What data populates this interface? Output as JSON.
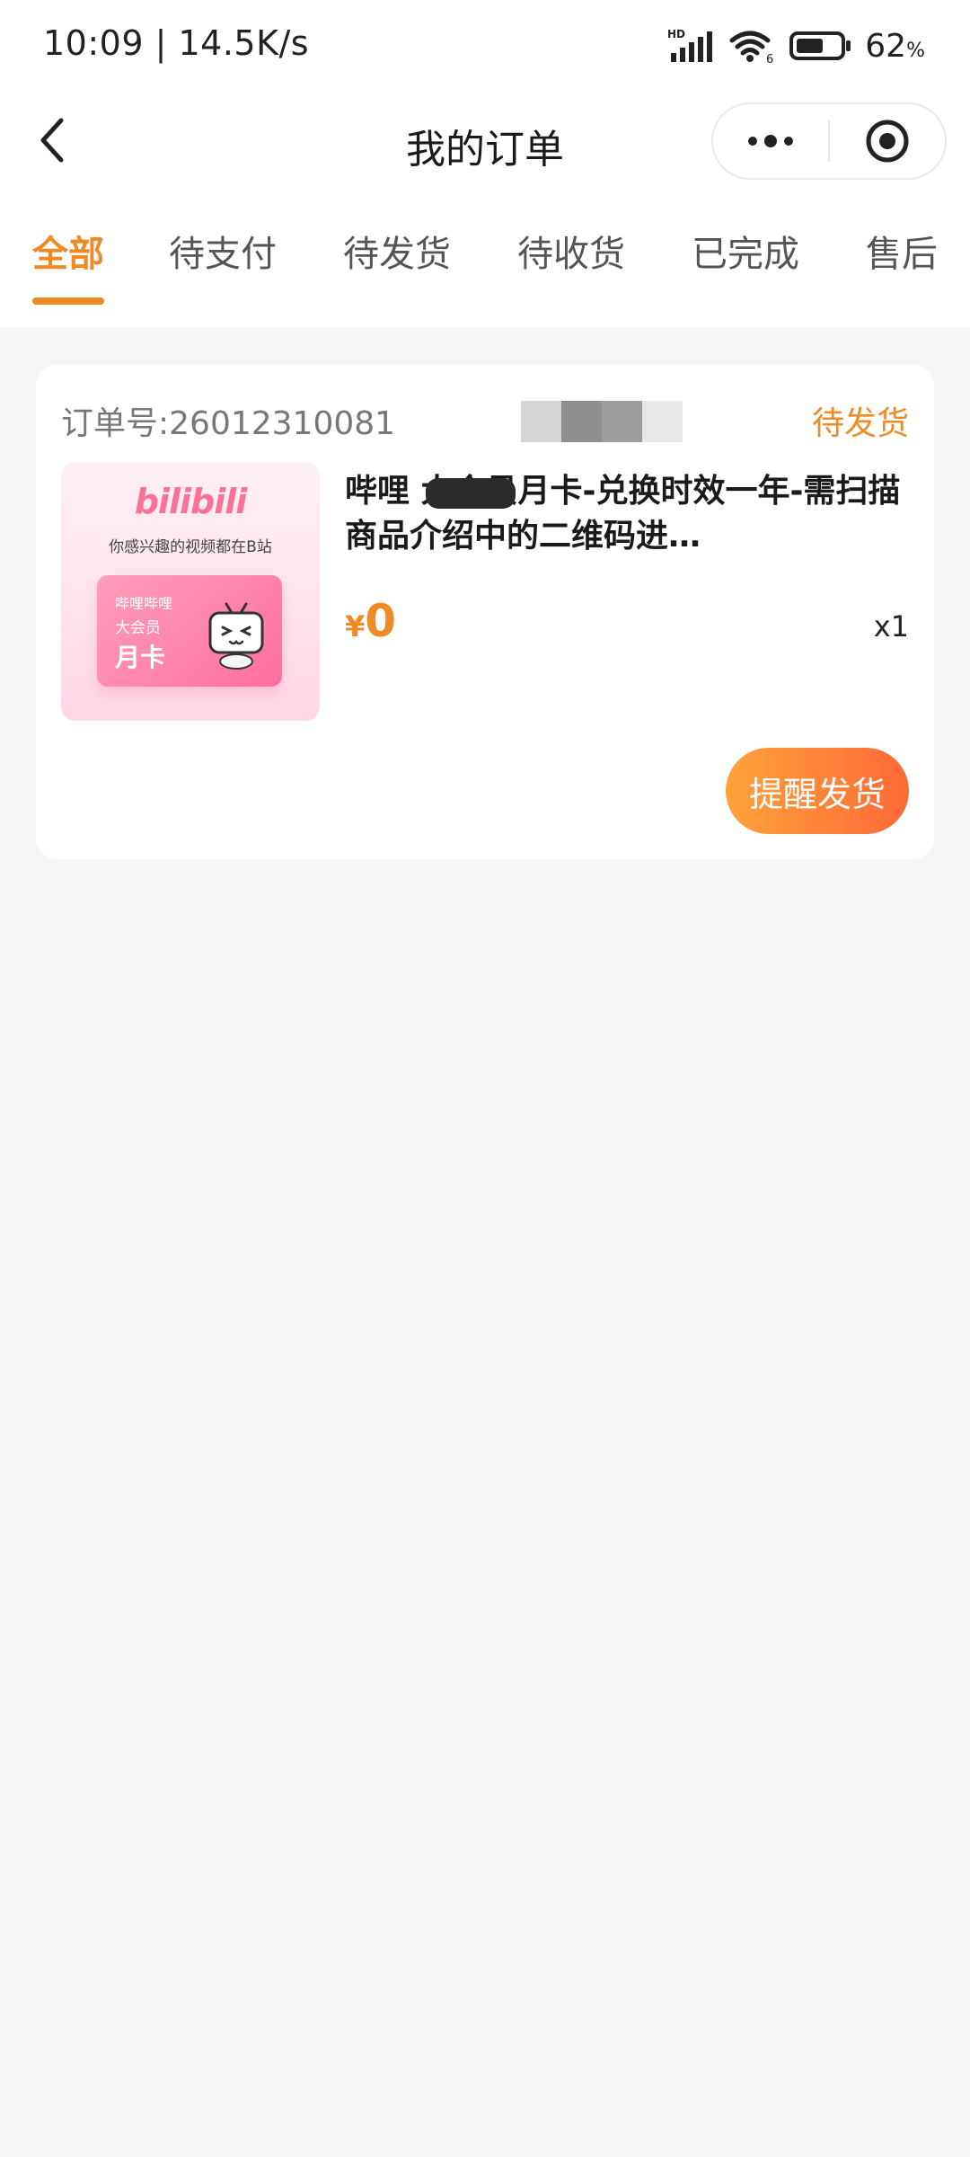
{
  "status_bar": {
    "time": "10:09 | 14.5K/s",
    "network_label": "HD",
    "wifi_label": "6",
    "battery_percent": "62",
    "battery_unit": "%",
    "battery_level": 0.62
  },
  "nav": {
    "title": "我的订单",
    "icons": {
      "back": "back-chevron-icon",
      "more": "more-dots-icon",
      "close": "target-close-icon"
    }
  },
  "tabs": [
    {
      "label": "全部",
      "active": true
    },
    {
      "label": "待支付",
      "active": false
    },
    {
      "label": "待发货",
      "active": false
    },
    {
      "label": "待收货",
      "active": false
    },
    {
      "label": "已完成",
      "active": false
    },
    {
      "label": "售后",
      "active": false
    }
  ],
  "order": {
    "order_number_label": "订单号:26012310081",
    "status": "待发货",
    "product": {
      "title": "哔哩      大会员月卡-兑换时效一年-需扫描商品介绍中的二维码进…",
      "image": {
        "brand": "bilibili",
        "tagline": "你感兴趣的视频都在B站",
        "card_line1": "哔哩哔哩",
        "card_line2": "大会员",
        "card_line3": "月卡"
      }
    },
    "price_symbol": "¥",
    "price_value": "0",
    "quantity": "x1",
    "action_button": "提醒发货"
  },
  "colors": {
    "accent": "#f08a24",
    "button_gradient_start": "#ffa23a",
    "button_gradient_end": "#ff6a37",
    "page_background": "#f6f6f6",
    "brand_pink": "#fb7299"
  }
}
